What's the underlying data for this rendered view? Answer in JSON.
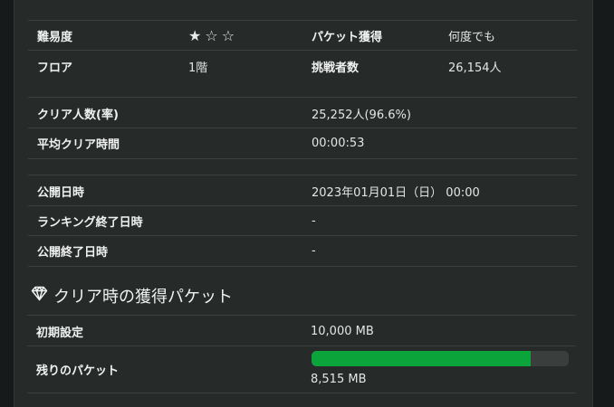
{
  "info": {
    "difficulty_label": "難易度",
    "difficulty_rating": 1,
    "difficulty_max": 5,
    "packet_label": "パケット獲得",
    "packet_value": "何度でも",
    "floor_label": "フロア",
    "floor_value": "1階",
    "challengers_label": "挑戦者数",
    "challengers_value": "26,154人"
  },
  "clear": {
    "clear_count_label": "クリア人数(率)",
    "clear_count_value": "25,252人(96.6%)",
    "avg_time_label": "平均クリア時間",
    "avg_time_value": "00:00:53"
  },
  "schedule": {
    "publish_label": "公開日時",
    "publish_value": "2023年01月01日（日） 00:00",
    "ranking_end_label": "ランキング終了日時",
    "ranking_end_value": "-",
    "publish_end_label": "公開終了日時",
    "publish_end_value": "-"
  },
  "packets": {
    "section_title": "クリア時の獲得パケット",
    "section_icon": "diamond-icon",
    "initial_label": "初期設定",
    "initial_value": "10,000 MB",
    "remaining_label": "残りのパケット",
    "remaining_value": "8,515 MB",
    "remaining_fraction": 0.8515
  },
  "colors": {
    "panel_bg": "#262a29",
    "page_bg": "#171a1a",
    "progress_fill": "#0aa43b",
    "progress_track": "#3a3f3e"
  }
}
